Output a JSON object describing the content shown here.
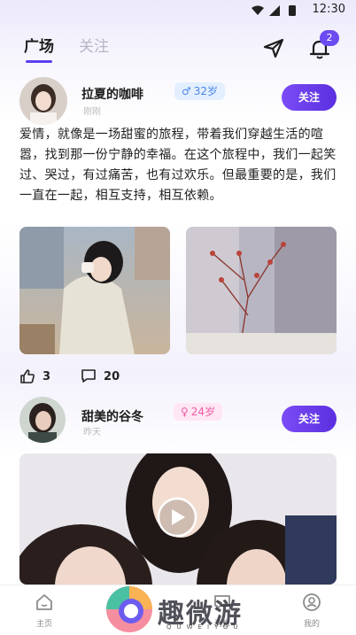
{
  "status_bar": {
    "time": "12:30"
  },
  "header": {
    "tabs": [
      {
        "label": "广场"
      },
      {
        "label": "关注"
      }
    ],
    "bell_badge": "2"
  },
  "posts": [
    {
      "username": "拉夏的咖啡",
      "age": "32岁",
      "gender": "male",
      "time": "刚刚",
      "follow_label": "关注",
      "text": "爱情，就像是一场甜蜜的旅程，带着我们穿越生活的喧嚣，找到那一份宁静的幸福。在这个旅程中，我们一起笑过、哭过，有过痛苦，也有过欢乐。但最重要的是，我们一直在一起，相互支持，相互依赖。",
      "likes": "3",
      "comments": "20"
    },
    {
      "username": "甜美的谷冬",
      "age": "24岁",
      "gender": "female",
      "time": "昨天",
      "follow_label": "关注"
    }
  ],
  "bottom_nav": {
    "items": [
      {
        "label": "主页",
        "icon": "home-icon"
      },
      {
        "label": "消息",
        "icon": "message-icon"
      },
      {
        "label": "我的",
        "icon": "profile-icon"
      }
    ]
  },
  "watermark": {
    "text": "趣微游",
    "sub": "QUWEIYOU"
  }
}
